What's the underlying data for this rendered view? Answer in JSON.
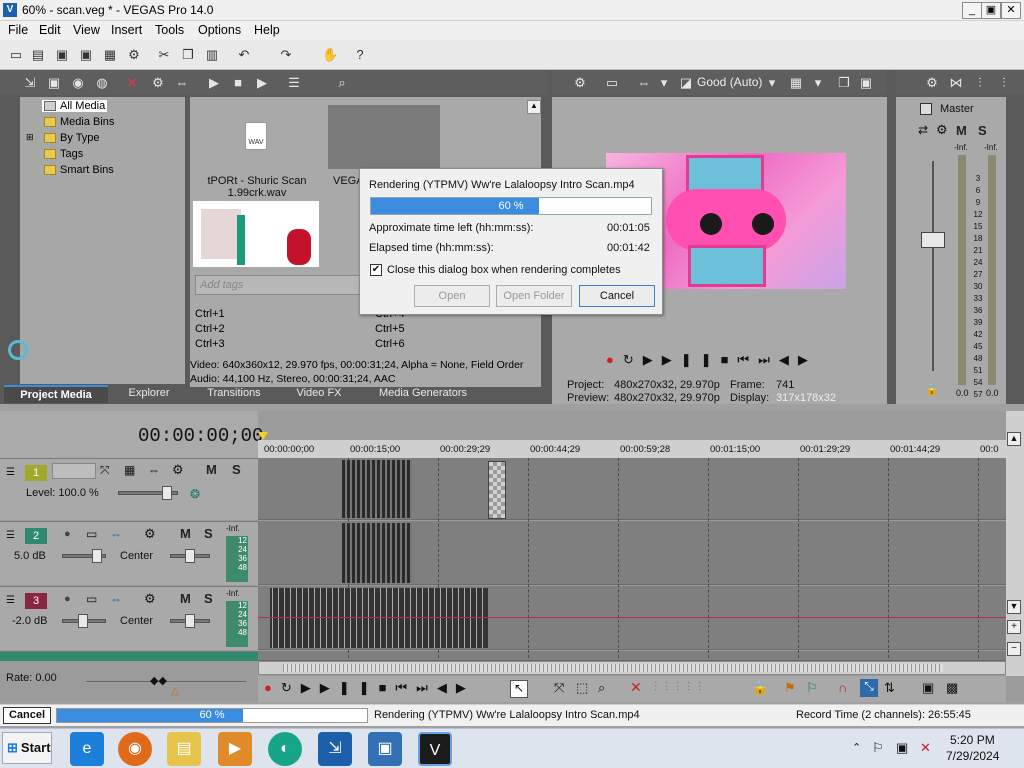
{
  "window": {
    "title": "60% - scan.veg * - VEGAS Pro 14.0",
    "min": "_",
    "max": "▣",
    "close": "✕"
  },
  "menu": [
    "File",
    "Edit",
    "View",
    "Insert",
    "Tools",
    "Options",
    "Help"
  ],
  "media_tree": [
    "All Media",
    "Media Bins",
    "By Type",
    "Tags",
    "Smart Bins"
  ],
  "media_items": {
    "item1_name": "tPORt - Shuric Scan 1.99crk.wav",
    "item2_name": "VEGA",
    "wav_label": "WAV"
  },
  "tags": {
    "placeholder": "Add tags",
    "shortcuts": [
      "Ctrl+1",
      "Ctrl+2",
      "Ctrl+3"
    ],
    "shortcuts2": [
      "Ctrl+4",
      "Ctrl+5",
      "Ctrl+6"
    ]
  },
  "media_info": {
    "video": "Video: 640x360x12, 29.970 fps, 00:00:31;24, Alpha = None, Field Order",
    "audio": "Audio: 44,100 Hz, Stereo, 00:00:31;24, AAC"
  },
  "tabs": [
    "Project Media",
    "Explorer",
    "Transitions",
    "Video FX",
    "Media Generators"
  ],
  "preview": {
    "quality": "Good (Auto)",
    "project_label": "Project:",
    "project_value": "480x270x32, 29.970p",
    "preview_label": "Preview:",
    "preview_value": "480x270x32, 29.970p",
    "frame_label": "Frame:",
    "frame_value": "741",
    "display_label": "Display:",
    "display_value": "317x178x32"
  },
  "master": {
    "title": "Master",
    "inf": "-Inf.",
    "scale": [
      "3",
      "6",
      "9",
      "12",
      "15",
      "18",
      "21",
      "24",
      "27",
      "30",
      "33",
      "36",
      "39",
      "42",
      "45",
      "48",
      "51",
      "54",
      "57"
    ],
    "readouts": [
      "0.0",
      "0.0"
    ],
    "m": "M",
    "s": "S"
  },
  "timeline": {
    "timecode": "00:00:00;00",
    "ruler": [
      "00:00:00;00",
      "00:00:15;00",
      "00:00:29;29",
      "00:00:44;29",
      "00:00:59;28",
      "00:01:15;00",
      "00:01:29;29",
      "00:01:44;29",
      "00:0"
    ],
    "rate": "Rate: 0.00"
  },
  "tracks": [
    {
      "num": "1",
      "type": "video",
      "level": "Level: 100.0 %"
    },
    {
      "num": "2",
      "type": "audio",
      "db": "5.0 dB",
      "pan": "Center",
      "meter": [
        "-Inf.",
        "12",
        "24",
        "36",
        "48"
      ]
    },
    {
      "num": "3",
      "type": "audio",
      "db": "-2.0 dB",
      "pan": "Center",
      "meter": [
        "-Inf.",
        "12",
        "24",
        "36",
        "48"
      ]
    }
  ],
  "dialog": {
    "title": "Rendering (YTPMV) Ww're Lalaloopsy Intro Scan.mp4",
    "progress_text": "60 %",
    "progress": 0.6,
    "time_left_label": "Approximate time left (hh:mm:ss):",
    "time_left": "00:01:05",
    "elapsed_label": "Elapsed time (hh:mm:ss):",
    "elapsed": "00:01:42",
    "checkbox_label": "Close this dialog box when rendering completes",
    "open": "Open",
    "open_folder": "Open Folder",
    "cancel": "Cancel"
  },
  "status": {
    "cancel": "Cancel",
    "progress_text": "60 %",
    "progress": 0.6,
    "message": "Rendering (YTPMV) Ww're Lalaloopsy Intro Scan.mp4",
    "record": "Record Time (2 channels): 26:55:45"
  },
  "taskbar": {
    "start": "Start",
    "time": "5:20 PM",
    "date": "7/29/2024"
  },
  "colors": {
    "accent": "#3c8de0",
    "track1": "#a3a82b",
    "track2": "#2f8a6f",
    "track3": "#8a2642"
  }
}
